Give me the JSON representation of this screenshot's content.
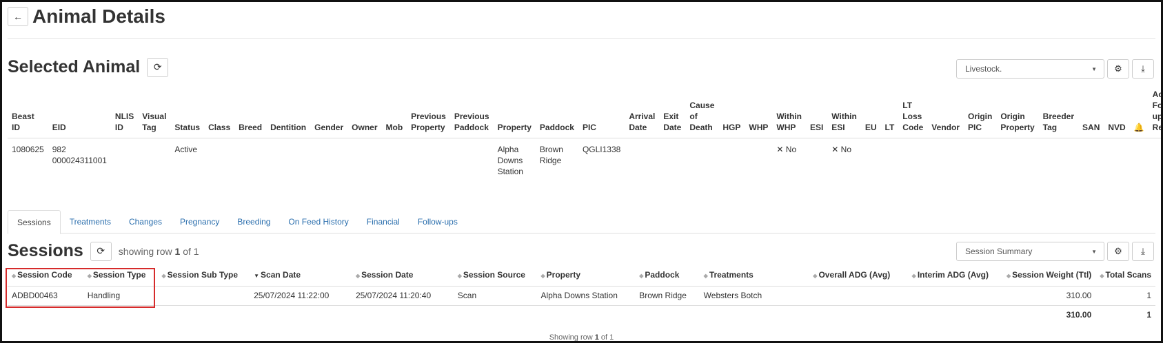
{
  "page": {
    "title": "Animal Details",
    "back_icon": "arrow-left-icon"
  },
  "selected_animal": {
    "title": "Selected Animal",
    "view_select": "Livestock.",
    "columns": [
      "Beast ID",
      "EID",
      "NLIS ID",
      "Visual Tag",
      "Status",
      "Class",
      "Breed",
      "Dentition",
      "Gender",
      "Owner",
      "Mob",
      "Previous Property",
      "Previous Paddock",
      "Property",
      "Paddock",
      "PIC",
      "Arrival Date",
      "Exit Date",
      "Cause of Death",
      "HGP",
      "WHP",
      "Within WHP",
      "ESI",
      "Within ESI",
      "EU",
      "LT",
      "LT Loss Code",
      "Vendor",
      "Origin PIC",
      "Origin Property",
      "Breeder Tag",
      "SAN",
      "NVD",
      "bell-icon",
      "Active Follow-up Reasons"
    ],
    "row": {
      "beast_id": "1080625",
      "eid": "982 000024311001",
      "status": "Active",
      "property": "Alpha Downs Station",
      "paddock": "Brown Ridge",
      "pic": "QGLI1338",
      "within_whp": "✕ No",
      "within_esi": "✕ No"
    }
  },
  "tabs": [
    "Sessions",
    "Treatments",
    "Changes",
    "Pregnancy",
    "Breeding",
    "On Feed History",
    "Financial",
    "Follow-ups"
  ],
  "sessions": {
    "title": "Sessions",
    "showing_prefix": "showing row",
    "showing_num": "1",
    "showing_of": "of",
    "showing_total": "1",
    "view_select": "Session Summary",
    "columns": [
      "Session Code",
      "Session Type",
      "Session Sub Type",
      "Scan Date",
      "Session Date",
      "Session Source",
      "Property",
      "Paddock",
      "Treatments",
      "Overall ADG (Avg)",
      "Interim ADG (Avg)",
      "Session Weight (Ttl)",
      "Total Scans"
    ],
    "rows": [
      [
        "ADBD00463",
        "Handling",
        "",
        "25/07/2024 11:22:00",
        "25/07/2024 11:20:40",
        "Scan",
        "Alpha Downs Station",
        "Brown Ridge",
        "Websters Botch",
        "",
        "",
        "310.00",
        "1"
      ]
    ],
    "totals": {
      "weight": "310.00",
      "scans": "1"
    },
    "footer_prefix": "Showing row",
    "footer_num": "1",
    "footer_of": "of",
    "footer_total": "1"
  }
}
